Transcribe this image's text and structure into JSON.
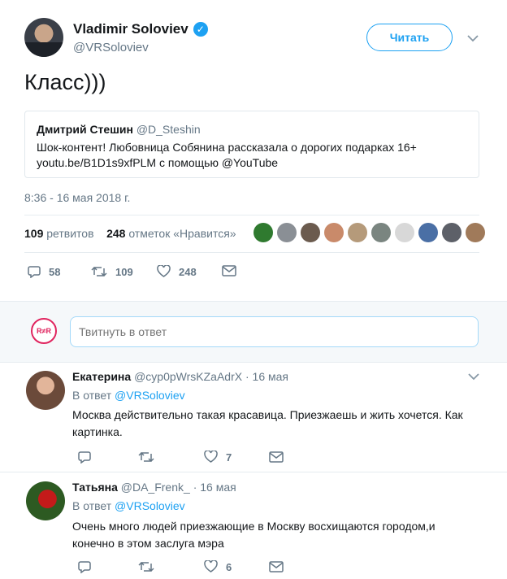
{
  "tweet": {
    "author_name": "Vladimir Soloviev",
    "author_handle": "@VRSoloviev",
    "follow_label": "Читать",
    "text": "Класс)))",
    "timestamp": "8:36 - 16 мая 2018 г."
  },
  "quote": {
    "name": "Дмитрий Стешин",
    "handle": "@D_Steshin",
    "line1": "Шок-контент! Любовница Собянина рассказала о дорогих подарках  16+",
    "line2": "youtu.be/B1D1s9xfPLM с помощью @YouTube"
  },
  "stats": {
    "retweets_count": "109",
    "retweets_label": "ретвитов",
    "likes_count": "248",
    "likes_label": "отметок «Нравится»"
  },
  "actions": {
    "replies": "58",
    "retweets": "109",
    "likes": "248"
  },
  "reply_box": {
    "placeholder": "Твитнуть в ответ",
    "logo": "R≠R"
  },
  "replies": [
    {
      "name": "Екатерина",
      "handle": "@cyp0pWrsKZaAdrX",
      "dot": "·",
      "date": "16 мая",
      "in_reply_prefix": "В ответ",
      "in_reply_to": "@VRSoloviev",
      "line1": "Москва действительно такая красавица. Приезжаешь и жить хочется. Как",
      "line2": "картинка.",
      "likes": "7"
    },
    {
      "name": "Татьяна",
      "handle": "@DA_Frenk_",
      "dot": "·",
      "date": "16 мая",
      "in_reply_prefix": "В ответ",
      "in_reply_to": "@VRSoloviev",
      "line1": "Очень много людей приезжающие в Москву восхищаются городом,и",
      "line2": "конечно в этом заслуга мэра",
      "likes": "6"
    }
  ],
  "colors": {
    "accent": "#1da1f2",
    "muted": "#657786",
    "divider": "#e6ecf0"
  },
  "icons": [
    "verified-icon",
    "chevron-down-icon",
    "reply-icon",
    "retweet-icon",
    "like-icon",
    "message-icon"
  ]
}
